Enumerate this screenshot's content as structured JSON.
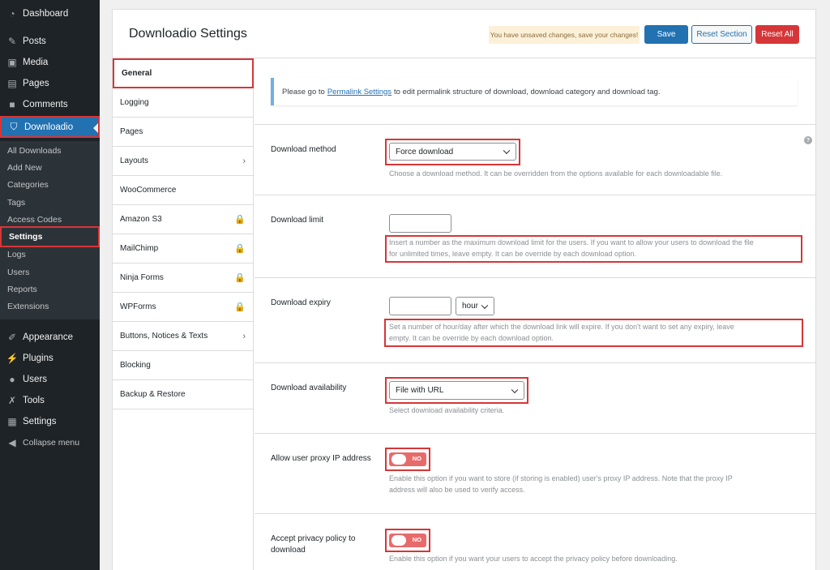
{
  "menu": {
    "items": [
      {
        "label": "Dashboard",
        "icon": "dashboard-icon"
      },
      {
        "label": "Posts",
        "icon": "pin-icon"
      },
      {
        "label": "Media",
        "icon": "media-icon"
      },
      {
        "label": "Pages",
        "icon": "pages-icon"
      },
      {
        "label": "Comments",
        "icon": "comment-icon"
      },
      {
        "label": "Downloadio",
        "icon": "shield-icon"
      },
      {
        "label": "Appearance",
        "icon": "brush-icon"
      },
      {
        "label": "Plugins",
        "icon": "plug-icon"
      },
      {
        "label": "Users",
        "icon": "user-icon"
      },
      {
        "label": "Tools",
        "icon": "wrench-icon"
      },
      {
        "label": "Settings",
        "icon": "settings-icon"
      },
      {
        "label": "Collapse menu",
        "icon": "collapse-icon"
      }
    ],
    "submenu": [
      "All Downloads",
      "Add New",
      "Categories",
      "Tags",
      "Access Codes",
      "Settings",
      "Logs",
      "Users",
      "Reports",
      "Extensions"
    ]
  },
  "header": {
    "title": "Downloadio Settings",
    "unsaved": "You have unsaved changes, save your changes!",
    "save": "Save",
    "reset_section": "Reset Section",
    "reset_all": "Reset All"
  },
  "tabs": [
    "General",
    "Logging",
    "Pages",
    "Layouts",
    "WooCommerce",
    "Amazon S3",
    "MailChimp",
    "Ninja Forms",
    "WPForms",
    "Buttons, Notices & Texts",
    "Blocking",
    "Backup & Restore"
  ],
  "notice": {
    "pre": "Please go to",
    "link": "Permalink Settings",
    "post": "to edit permalink structure of download, download category and download tag."
  },
  "fields": {
    "method": {
      "label": "Download method",
      "value": "Force download",
      "desc": "Choose a download method. It can be overridden from the options available for each downloadable file."
    },
    "limit": {
      "label": "Download limit",
      "value": "",
      "desc1": "Insert a number as the maximum download limit for the users. If you want to allow your users to download the file",
      "desc2": "for unlimited times, leave empty. It can be override by each download option."
    },
    "expiry": {
      "label": "Download expiry",
      "unit": "hour",
      "desc1": "Set a number of hour/day after which the download link will expire. If you don't want to set any expiry, leave",
      "desc2": "empty. It can be override by each download option."
    },
    "availability": {
      "label": "Download availability",
      "value": "File with URL",
      "desc": "Select download availability criteria."
    },
    "proxy": {
      "label": "Allow user proxy IP address",
      "toggle": "NO",
      "desc1": "Enable this option if you want to store (if storing is enabled) user's proxy IP address. Note that the proxy IP",
      "desc2": "address will also be used to verify access."
    },
    "privacy": {
      "label1": "Accept privacy policy to",
      "label2": "download",
      "toggle": "NO",
      "desc": "Enable this option if you want your users to accept the privacy policy before downloading."
    }
  },
  "colors": {
    "accent": "#2271b1",
    "danger": "#d63638",
    "sidebar": "#1d2327"
  }
}
